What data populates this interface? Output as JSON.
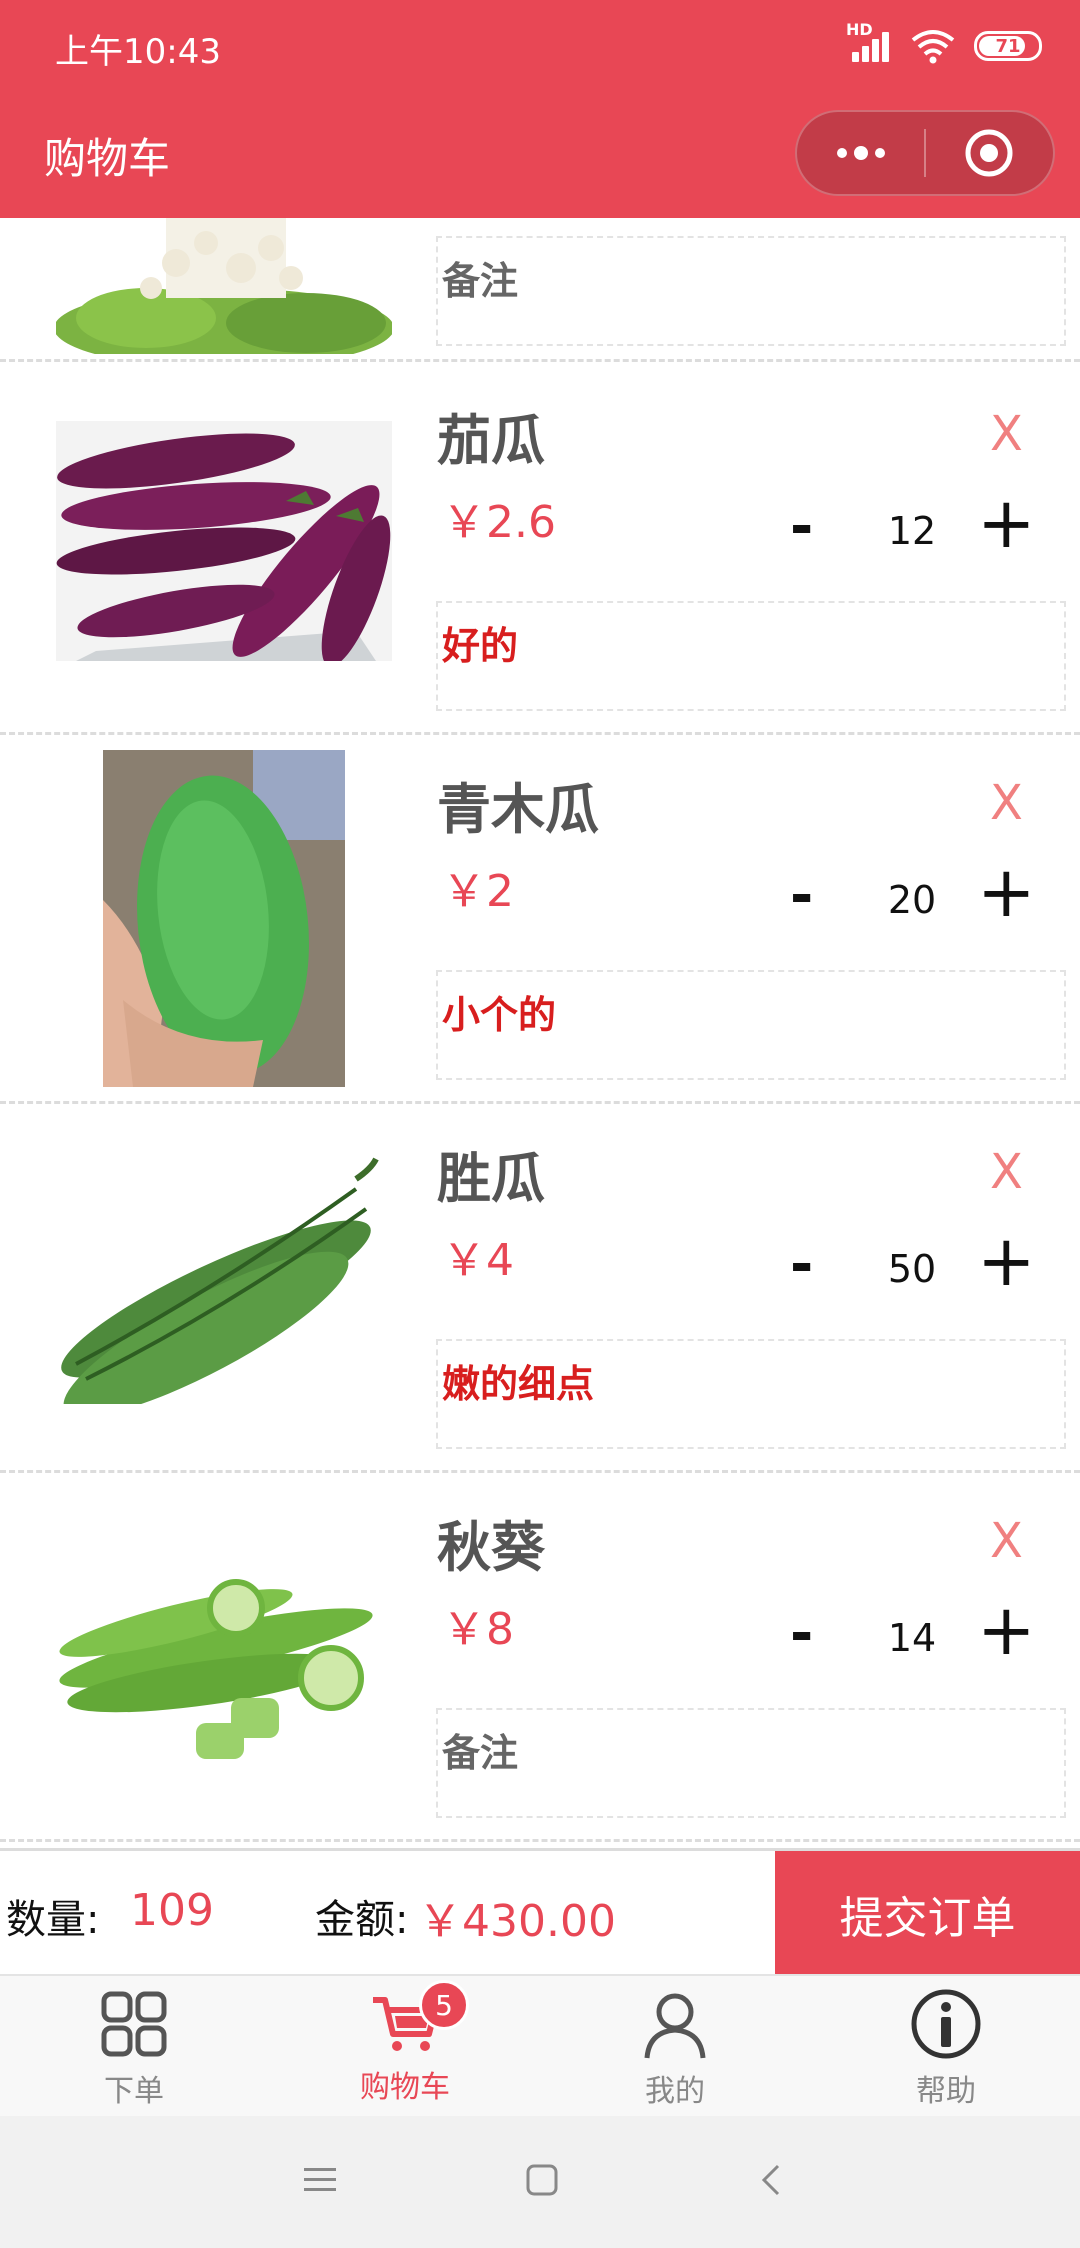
{
  "status_bar": {
    "time": "上午10:43",
    "battery": "71",
    "network_badge": "HD"
  },
  "header": {
    "title": "购物车"
  },
  "items": [
    {
      "name": "",
      "price": "",
      "qty": "",
      "note": "备注",
      "note_placeholder": true,
      "image": "mushroom-image"
    },
    {
      "name": "茄瓜",
      "price": "￥2.6",
      "qty": "12",
      "note": "好的",
      "note_placeholder": false,
      "image": "eggplant-image",
      "remove": "X",
      "minus": "-",
      "plus": "+"
    },
    {
      "name": "青木瓜",
      "price": "￥2",
      "qty": "20",
      "note": "小个的",
      "note_placeholder": false,
      "image": "papaya-image",
      "remove": "X",
      "minus": "-",
      "plus": "+"
    },
    {
      "name": "胜瓜",
      "price": "￥4",
      "qty": "50",
      "note": "嫩的细点",
      "note_placeholder": false,
      "image": "luffa-image",
      "remove": "X",
      "minus": "-",
      "plus": "+"
    },
    {
      "name": "秋葵",
      "price": "￥8",
      "qty": "14",
      "note": "备注",
      "note_placeholder": true,
      "image": "okra-image",
      "remove": "X",
      "minus": "-",
      "plus": "+"
    }
  ],
  "summary": {
    "qty_label": "数量:",
    "qty_value": "109",
    "amount_label": "金额:",
    "amount_value": "￥430.00",
    "submit_label": "提交订单"
  },
  "tabbar": {
    "tabs": [
      {
        "label": "下单",
        "icon": "grid-icon",
        "active": false
      },
      {
        "label": "购物车",
        "icon": "cart-icon",
        "active": true,
        "badge": "5"
      },
      {
        "label": "我的",
        "icon": "user-icon",
        "active": false
      },
      {
        "label": "帮助",
        "icon": "info-icon",
        "active": false
      }
    ]
  },
  "colors": {
    "accent": "#e84755",
    "note_text": "#d81e1e",
    "remove": "#f08080"
  }
}
